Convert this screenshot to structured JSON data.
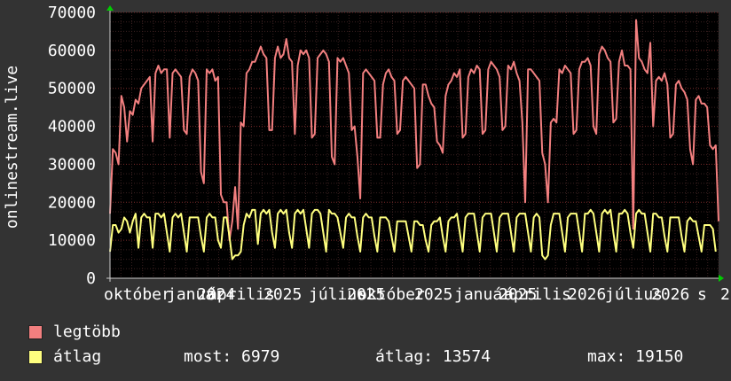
{
  "chart_data": {
    "type": "line",
    "ylabel": "onlinestream.live",
    "ylim": [
      0,
      70000
    ],
    "y_ticks": [
      0,
      10000,
      20000,
      30000,
      40000,
      50000,
      60000,
      70000
    ],
    "x_tick_labels": [
      "október",
      "január",
      "2024",
      "április",
      "2025",
      "július",
      "2025",
      "október",
      "2025",
      "január",
      "2025",
      "április",
      "2026",
      "július",
      "2026",
      "s",
      "2"
    ],
    "background": "#000000",
    "grid": true,
    "series": [
      {
        "name": "legtöbb",
        "color": "#f27f7f",
        "values": [
          17000,
          34000,
          33000,
          30000,
          48000,
          45000,
          36000,
          44000,
          43000,
          47000,
          46000,
          50000,
          51000,
          52000,
          53000,
          36000,
          54000,
          56000,
          54000,
          55000,
          55000,
          37000,
          54000,
          55000,
          54000,
          53000,
          39000,
          38000,
          53000,
          55000,
          54000,
          52000,
          28000,
          25000,
          55000,
          54000,
          55000,
          52000,
          53000,
          22000,
          20000,
          20000,
          10000,
          15000,
          24000,
          13000,
          41000,
          40000,
          54000,
          55000,
          57000,
          57000,
          59000,
          61000,
          59000,
          58000,
          39000,
          39000,
          58000,
          61000,
          58000,
          59000,
          63000,
          58000,
          57000,
          38000,
          56000,
          60000,
          59000,
          60000,
          58000,
          37000,
          38000,
          58000,
          59000,
          60000,
          59000,
          57000,
          32000,
          30000,
          58000,
          57000,
          58000,
          56000,
          54000,
          39000,
          40000,
          32000,
          21000,
          54000,
          55000,
          54000,
          53000,
          52000,
          37000,
          37000,
          51000,
          54000,
          55000,
          53000,
          52000,
          38000,
          39000,
          52000,
          53000,
          52000,
          51000,
          50000,
          29000,
          30000,
          51000,
          51000,
          48000,
          46000,
          45000,
          36000,
          35000,
          33000,
          48000,
          51000,
          52000,
          54000,
          53000,
          55000,
          37000,
          38000,
          53000,
          55000,
          54000,
          56000,
          55000,
          38000,
          39000,
          55000,
          57000,
          56000,
          55000,
          53000,
          39000,
          40000,
          56000,
          55000,
          57000,
          54000,
          52000,
          41000,
          20000,
          55000,
          55000,
          54000,
          53000,
          52000,
          33000,
          30000,
          20000,
          41000,
          42000,
          41000,
          55000,
          54000,
          56000,
          55000,
          54000,
          38000,
          39000,
          55000,
          57000,
          57000,
          58000,
          56000,
          40000,
          38000,
          59000,
          61000,
          60000,
          58000,
          57000,
          41000,
          42000,
          57000,
          60000,
          56000,
          56000,
          55000,
          13000,
          68000,
          58000,
          57000,
          55000,
          54000,
          62000,
          40000,
          52000,
          53000,
          52000,
          54000,
          51000,
          37000,
          38000,
          51000,
          52000,
          50000,
          49000,
          47000,
          34000,
          30000,
          47000,
          48000,
          46000,
          46000,
          45000,
          35000,
          34000,
          35000,
          15000
        ]
      },
      {
        "name": "átlag",
        "color": "#ffff7f",
        "values": [
          7000,
          14000,
          14000,
          12000,
          13000,
          16000,
          15000,
          12000,
          15000,
          17000,
          8000,
          16000,
          17000,
          16000,
          16000,
          8000,
          17000,
          17000,
          16000,
          17000,
          12000,
          7000,
          16000,
          17000,
          16000,
          17000,
          12000,
          7000,
          16000,
          16000,
          16000,
          16000,
          11000,
          7000,
          16000,
          17000,
          16000,
          16000,
          10000,
          8000,
          16000,
          16000,
          11000,
          5000,
          6000,
          6000,
          7000,
          14000,
          17000,
          16000,
          18000,
          18000,
          9000,
          17000,
          18000,
          17000,
          18000,
          12000,
          8000,
          17000,
          18000,
          17000,
          18000,
          12000,
          8000,
          17000,
          18000,
          17000,
          18000,
          13000,
          8000,
          17000,
          18000,
          18000,
          17000,
          12000,
          7000,
          18000,
          17000,
          17000,
          16000,
          12000,
          8000,
          16000,
          17000,
          16000,
          16000,
          11000,
          7000,
          16000,
          17000,
          16000,
          16000,
          11000,
          7000,
          16000,
          16000,
          16000,
          15000,
          11000,
          7000,
          15000,
          15000,
          15000,
          15000,
          11000,
          7000,
          15000,
          15000,
          14000,
          14000,
          10000,
          7000,
          14000,
          15000,
          15000,
          16000,
          11000,
          7000,
          15000,
          16000,
          16000,
          17000,
          12000,
          7000,
          16000,
          17000,
          17000,
          17000,
          12000,
          7000,
          16000,
          17000,
          17000,
          17000,
          12000,
          7000,
          16000,
          17000,
          17000,
          17000,
          12000,
          7000,
          16000,
          17000,
          17000,
          17000,
          12000,
          7000,
          16000,
          17000,
          16000,
          6000,
          5000,
          6000,
          14000,
          17000,
          17000,
          17000,
          12000,
          7000,
          16000,
          17000,
          17000,
          17000,
          12000,
          7000,
          17000,
          17000,
          18000,
          17000,
          12000,
          7000,
          17000,
          18000,
          17000,
          18000,
          12000,
          7000,
          17000,
          17000,
          18000,
          17000,
          12000,
          8000,
          17000,
          18000,
          17000,
          17000,
          12000,
          7000,
          17000,
          17000,
          16000,
          16000,
          11000,
          7000,
          16000,
          16000,
          16000,
          16000,
          11000,
          7000,
          15000,
          16000,
          15000,
          15000,
          11000,
          7000,
          14000,
          14000,
          14000,
          13000,
          7000
        ]
      }
    ]
  },
  "legend": {
    "max_label": "legtöbb",
    "avg_label": "átlag",
    "max_color": "#f27f7f",
    "avg_color": "#ffff7f"
  },
  "stats": {
    "now": "most: 6979",
    "avg": "átlag: 13574",
    "max": "max: 19150"
  }
}
